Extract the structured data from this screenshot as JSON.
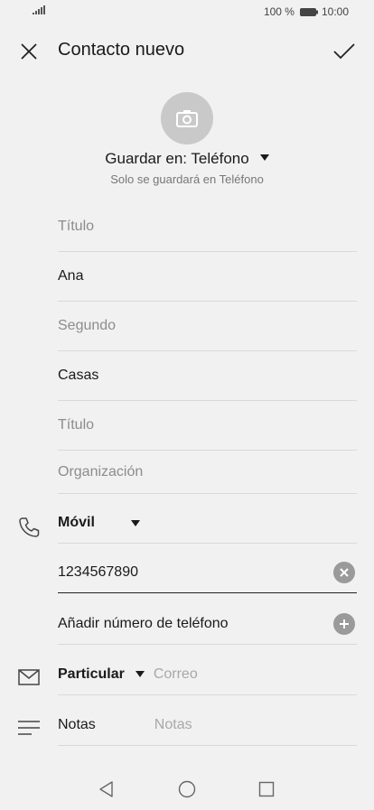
{
  "status_bar": {
    "battery": "100 %",
    "time": "10:00",
    "icons": [
      "signal-icon",
      "battery-icon"
    ]
  },
  "app_bar": {
    "title": "Contacto nuevo",
    "icons": [
      "close-icon",
      "check-icon"
    ]
  },
  "photo": {
    "icon": "camera-icon"
  },
  "save": {
    "label": "Guardar en: Teléfono",
    "note": "Solo se guardará en Teléfono"
  },
  "fields": {
    "title_prefix": "Título",
    "first_name": "Ana",
    "middle_name": "Segundo",
    "last_name": "Casas",
    "title_suffix": "Título",
    "organization": "Organización"
  },
  "phone": {
    "icon": "phone-icon",
    "type": "Móvil",
    "number": "1234567890",
    "add_label": "Añadir número de teléfono",
    "clear_icon": "clear-icon",
    "add_icon": "add-icon"
  },
  "email": {
    "icon": "mail-icon",
    "type": "Particular",
    "placeholder": "Correo"
  },
  "notes": {
    "icon": "notes-icon",
    "label": "Notas",
    "placeholder": "Notas"
  },
  "nav": {
    "icons": [
      "back-icon",
      "home-icon",
      "recents-icon"
    ]
  },
  "colors": {
    "background": "#f1f1f1",
    "photo_circle": "#c9c9c9",
    "action_circle": "#9a9a9a",
    "placeholder_text": "#8c8c8c"
  }
}
